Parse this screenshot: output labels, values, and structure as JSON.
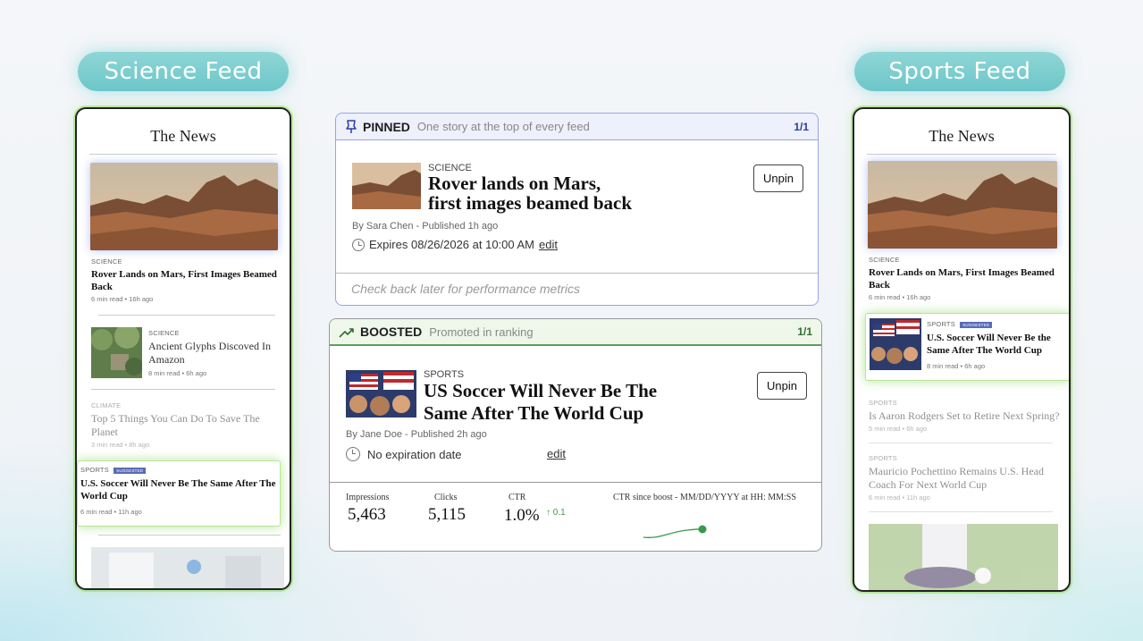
{
  "left_feed": {
    "pill": "Science Feed",
    "masthead": "The News",
    "hero": {
      "kicker": "SCIENCE",
      "headline": "Rover Lands on Mars, First Images Beamed Back",
      "meta": "6 min read • 16h ago"
    },
    "item2": {
      "kicker": "SCIENCE",
      "headline": "Ancient Glyphs Discoved In Amazon",
      "meta": "8 min read • 6h ago"
    },
    "item3": {
      "kicker": "CLIMATE",
      "headline": "Top 5 Things You Can Do To Save The Planet",
      "meta": "3 min read • 8h ago"
    },
    "item4": {
      "kicker": "SPORTS",
      "badge": "Suggested",
      "headline": "U.S. Soccer Will Never Be The Same After The World Cup",
      "meta": "6 min read • 11h ago"
    }
  },
  "right_feed": {
    "pill": "Sports Feed",
    "masthead": "The News",
    "hero": {
      "kicker": "SCIENCE",
      "headline": "Rover Lands on Mars, First Images Beamed Back",
      "meta": "6 min read • 16h ago"
    },
    "item2": {
      "kicker": "SPORTS",
      "badge": "Suggested",
      "headline": "U.S. Soccer Will Never Be the Same After The World Cup",
      "meta": "8 min read • 6h ago"
    },
    "item3": {
      "kicker": "SPORTS",
      "headline": "Is Aaron Rodgers Set to Retire Next Spring?",
      "meta": "5 min read • 6h ago"
    },
    "item4": {
      "kicker": "SPORTS",
      "headline": "Mauricio Pochettino Remains U.S. Head Coach For Next World Cup",
      "meta": "6 min read • 11h ago"
    }
  },
  "pinned": {
    "label": "PINNED",
    "description": "One story at the top of every feed",
    "count": "1/1",
    "kicker": "SCIENCE",
    "headline_line1": "Rover lands on Mars,",
    "headline_line2": "first images beamed back",
    "byline": "By Sara Chen - Published 1h ago",
    "expires": "Expires 08/26/2026 at 10:00 AM",
    "edit": "edit",
    "unpin": "Unpin",
    "footer": "Check back later for performance metrics"
  },
  "boosted": {
    "label": "BOOSTED",
    "description": "Promoted in ranking",
    "count": "1/1",
    "kicker": "SPORTS",
    "headline_line1": "US Soccer Will Never Be The",
    "headline_line2": "Same After The World Cup",
    "byline": "By Jane Doe - Published 2h ago",
    "expires": "No expiration date",
    "edit": "edit",
    "unpin": "Unpin",
    "metrics": {
      "impressions_label": "Impressions",
      "impressions": "5,463",
      "clicks_label": "Clicks",
      "clicks": "5,115",
      "ctr_label": "CTR",
      "ctr": "1.0%",
      "ctr_delta": "↑ 0.1",
      "ctr_since_label": "CTR since boost - MM/DD/YYYY at HH: MM:SS"
    }
  },
  "colors": {
    "pill": "#6cc6c8",
    "accent_green": "#3a9a4a",
    "accent_blue": "#2a3aa8"
  }
}
